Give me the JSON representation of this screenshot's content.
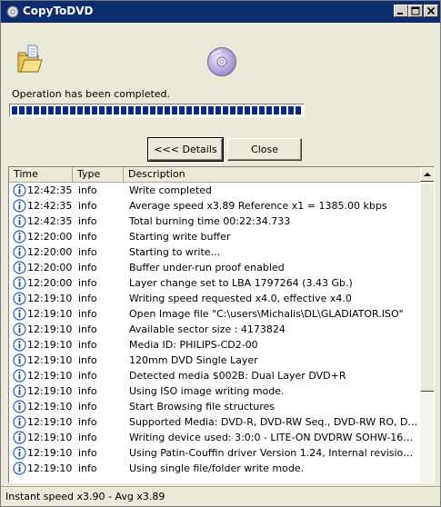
{
  "window": {
    "title": "CopyToDVD",
    "icons": {
      "app": "copytodvd-app-icon",
      "minimize": "minimize-icon",
      "maximize": "maximize-icon",
      "close": "close-icon"
    }
  },
  "status": {
    "message": "Operation has been completed.",
    "progress_percent": 100
  },
  "buttons": {
    "details": "<<< Details",
    "close": "Close"
  },
  "log": {
    "columns": [
      "Time",
      "Type",
      "Description"
    ],
    "rows": [
      {
        "time": "12:42:35",
        "type": "info",
        "description": "Write completed"
      },
      {
        "time": "12:42:35",
        "type": "info",
        "description": "Average speed x3.89 Reference x1 = 1385.00 kbps"
      },
      {
        "time": "12:42:35",
        "type": "info",
        "description": "Total burning time 00:22:34.733"
      },
      {
        "time": "12:20:00",
        "type": "info",
        "description": "Starting write buffer"
      },
      {
        "time": "12:20:00",
        "type": "info",
        "description": "Starting to write..."
      },
      {
        "time": "12:20:00",
        "type": "info",
        "description": "Buffer under-run proof enabled"
      },
      {
        "time": "12:20:00",
        "type": "info",
        "description": "Layer change set to LBA 1797264 (3.43 Gb.)"
      },
      {
        "time": "12:19:10",
        "type": "info",
        "description": "Writing speed requested x4.0, effective x4.0"
      },
      {
        "time": "12:19:10",
        "type": "info",
        "description": "Open Image file \"C:\\users\\Michalis\\DL\\GLADIATOR.ISO\""
      },
      {
        "time": "12:19:10",
        "type": "info",
        "description": "Available sector size : 4173824"
      },
      {
        "time": "12:19:10",
        "type": "info",
        "description": "Media ID: PHILIPS-CD2-00"
      },
      {
        "time": "12:19:10",
        "type": "info",
        "description": "120mm DVD Single Layer"
      },
      {
        "time": "12:19:10",
        "type": "info",
        "description": "Detected media $002B: Dual Layer DVD+R"
      },
      {
        "time": "12:19:10",
        "type": "info",
        "description": "Using ISO image writing mode."
      },
      {
        "time": "12:19:10",
        "type": "info",
        "description": "Start Browsing file structures"
      },
      {
        "time": "12:19:10",
        "type": "info",
        "description": "Supported Media: DVD-R, DVD-RW Seq., DVD-RW RO, DVD+R, DV..."
      },
      {
        "time": "12:19:10",
        "type": "info",
        "description": "Writing device used: 3:0:0 - LITE-ON DVDRW SOHW-1673S JS02 [..."
      },
      {
        "time": "12:19:10",
        "type": "info",
        "description": "Using Patin-Couffin driver Version 1.24, Internal revision 24"
      },
      {
        "time": "12:19:10",
        "type": "info",
        "description": "Using single file/folder write mode."
      }
    ]
  },
  "statusbar": {
    "text": "Instant speed x3.90 - Avg x3.89"
  }
}
